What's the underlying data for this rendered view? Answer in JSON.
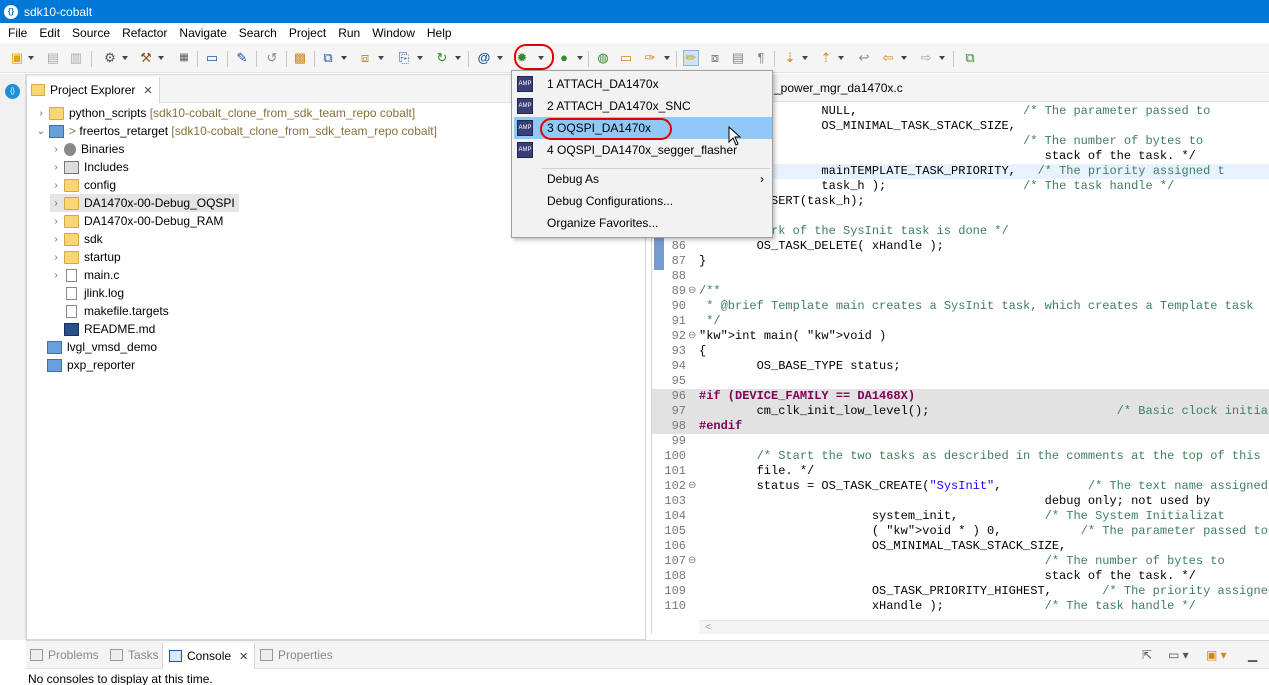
{
  "window": {
    "title": "sdk10-cobalt"
  },
  "menu": [
    "File",
    "Edit",
    "Source",
    "Refactor",
    "Navigate",
    "Search",
    "Project",
    "Run",
    "Window",
    "Help"
  ],
  "project_explorer": {
    "tab_label": "Project Explorer",
    "items": [
      {
        "name": "python_scripts",
        "suffix": "[sdk10-cobalt_clone_from_sdk_team_repo cobalt]"
      },
      {
        "name": "freertos_retarget",
        "prefix": ">",
        "suffix": "[sdk10-cobalt_clone_from_sdk_team_repo cobalt]"
      },
      {
        "name": "Binaries"
      },
      {
        "name": "Includes"
      },
      {
        "name": "config"
      },
      {
        "name": "DA1470x-00-Debug_OQSPI"
      },
      {
        "name": "DA1470x-00-Debug_RAM"
      },
      {
        "name": "sdk"
      },
      {
        "name": "startup"
      },
      {
        "name": "main.c"
      },
      {
        "name": "jlink.log"
      },
      {
        "name": "makefile.targets"
      },
      {
        "name": "README.md"
      },
      {
        "name": "lvgl_vmsd_demo"
      },
      {
        "name": "pxp_reporter"
      }
    ]
  },
  "editor": {
    "tab_label": "_power_mgr_da1470x.c",
    "lines": [
      {
        "n": "",
        "t": "                 NULL,                       /* The parameter passed to"
      },
      {
        "n": "",
        "t": "                 OS_MINIMAL_TASK_STACK_SIZE,"
      },
      {
        "n": "",
        "t": "                                             /* The number of bytes to"
      },
      {
        "n": "",
        "t": "                                                stack of the task. */"
      },
      {
        "n": "",
        "t": "                 mainTEMPLATE_TASK_PRIORITY,   /* The priority assigned t"
      },
      {
        "n": "",
        "t": "                 task_h );                   /* The task handle */"
      },
      {
        "n": "",
        "t": "        ASSERT(task_h);"
      },
      {
        "n": "",
        "t": ""
      },
      {
        "n": "",
        "t": "    the work of the SysInit task is done */"
      },
      {
        "n": "86",
        "t": "        OS_TASK_DELETE( xHandle );"
      },
      {
        "n": "87",
        "t": "}"
      },
      {
        "n": "88",
        "t": ""
      },
      {
        "n": "89",
        "t": "/**"
      },
      {
        "n": "90",
        "t": " * @brief Template main creates a SysInit task, which creates a Template task"
      },
      {
        "n": "91",
        "t": " */"
      },
      {
        "n": "92",
        "t": "int main( void )"
      },
      {
        "n": "93",
        "t": "{"
      },
      {
        "n": "94",
        "t": "        OS_BASE_TYPE status;"
      },
      {
        "n": "95",
        "t": ""
      },
      {
        "n": "96",
        "t": "#if (DEVICE_FAMILY == DA1468X)"
      },
      {
        "n": "97",
        "t": "        cm_clk_init_low_level();                          /* Basic clock initializ"
      },
      {
        "n": "98",
        "t": "#endif"
      },
      {
        "n": "99",
        "t": ""
      },
      {
        "n": "100",
        "t": "        /* Start the two tasks as described in the comments at the top of this"
      },
      {
        "n": "101",
        "t": "        file. */"
      },
      {
        "n": "102",
        "t": "        status = OS_TASK_CREATE(\"SysInit\",            /* The text name assigned"
      },
      {
        "n": "103",
        "t": "                                                debug only; not used by"
      },
      {
        "n": "104",
        "t": "                        system_init,            /* The System Initializat"
      },
      {
        "n": "105",
        "t": "                        ( void * ) 0,           /* The parameter passed to"
      },
      {
        "n": "106",
        "t": "                        OS_MINIMAL_TASK_STACK_SIZE,"
      },
      {
        "n": "107",
        "t": "                                                /* The number of bytes to"
      },
      {
        "n": "108",
        "t": "                                                stack of the task. */"
      },
      {
        "n": "109",
        "t": "                        OS_TASK_PRIORITY_HIGHEST,       /* The priority assigned t"
      },
      {
        "n": "110",
        "t": "                        xHandle );              /* The task handle */"
      }
    ]
  },
  "debug_menu": {
    "items": [
      {
        "label": "1 ATTACH_DA1470x",
        "icon": "debug-config-icon"
      },
      {
        "label": "2 ATTACH_DA1470x_SNC",
        "icon": "debug-config-icon"
      },
      {
        "label": "3 OQSPI_DA1470x",
        "icon": "debug-config-icon"
      },
      {
        "label": "4 OQSPI_DA1470x_segger_flasher",
        "icon": "debug-config-icon"
      }
    ],
    "debug_as": "Debug As",
    "debug_configurations": "Debug Configurations...",
    "organize_favorites": "Organize Favorites..."
  },
  "bottom_panel": {
    "tabs": [
      "Problems",
      "Tasks",
      "Console",
      "Properties"
    ],
    "active": "Console",
    "message": "No consoles to display at this time."
  },
  "colors": {
    "titlebar": "#0078d7",
    "highlight": "#90c8f6",
    "annotation": "#e00000"
  }
}
